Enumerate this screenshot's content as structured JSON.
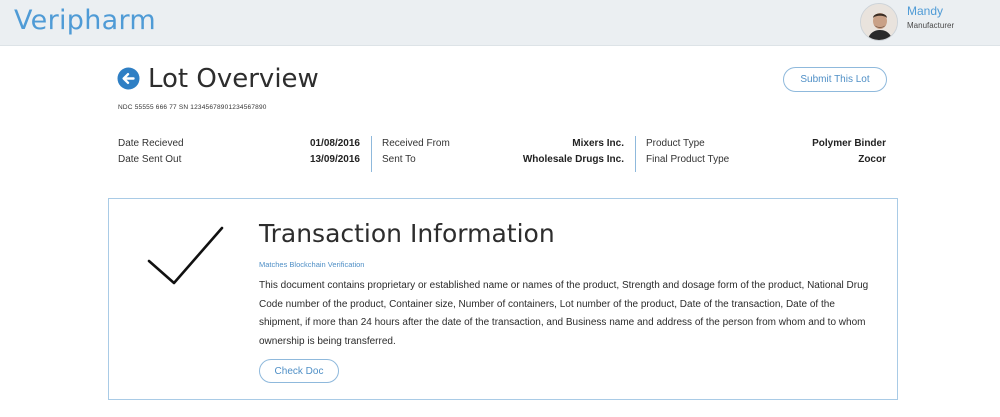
{
  "header": {
    "brand": "Veripharm",
    "user_name": "Mandy",
    "user_role": "Manufacturer"
  },
  "lot": {
    "title": "Lot Overview",
    "ndc_line": "NDC 55555 666 77 SN 12345678901234567890",
    "submit_label": "Submit This Lot"
  },
  "details": {
    "date_received_label": "Date Recieved",
    "date_received_value": "01/08/2016",
    "date_sent_label": "Date Sent Out",
    "date_sent_value": "13/09/2016",
    "received_from_label": "Received From",
    "received_from_value": "Mixers Inc.",
    "sent_to_label": "Sent To",
    "sent_to_value": "Wholesale Drugs Inc.",
    "product_type_label": "Product Type",
    "product_type_value": "Polymer Binder",
    "final_product_type_label": "Final Product Type",
    "final_product_type_value": "Zocor"
  },
  "transaction": {
    "title": "Transaction Information",
    "verification": "Matches Blockchain Verification",
    "description": "This document contains proprietary or established name or names of the product, Strength and dosage form of the product, National Drug Code number of the product, Container size, Number of containers, Lot number of the product, Date of the transaction, Date of the shipment, if more than 24 hours after the date of the transaction, and Business name and address of the person from whom and to whom ownership is being transferred.",
    "check_doc_label": "Check Doc",
    "status_icon": "checkmark-icon"
  },
  "icons": {
    "back": "back-arrow-icon",
    "avatar": "user-avatar"
  },
  "colors": {
    "brand": "#4f9bd6",
    "accent": "#4f8fc6",
    "header_bg": "#ebeff2",
    "border": "#a9cbe6"
  }
}
